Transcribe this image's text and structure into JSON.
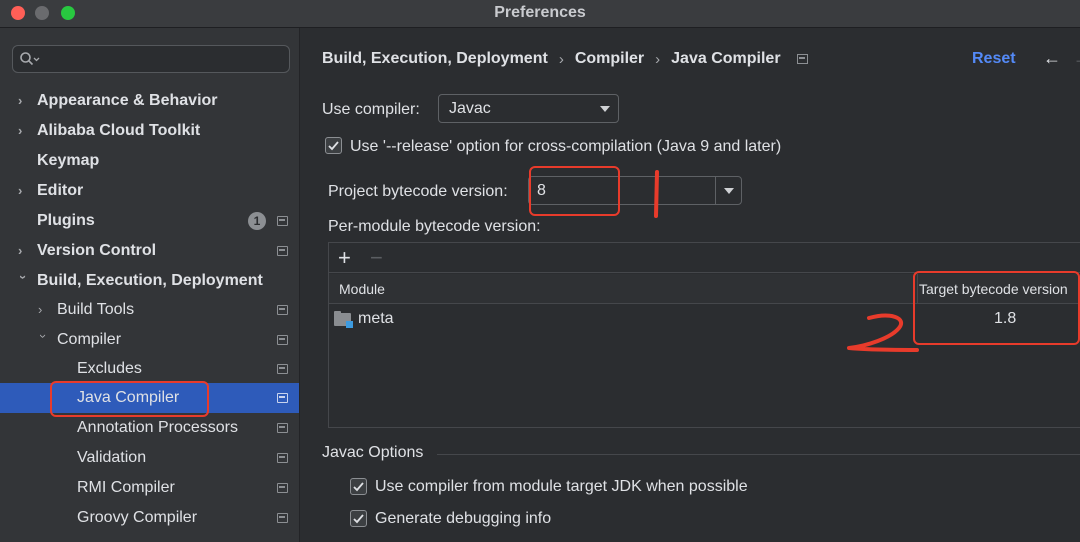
{
  "window": {
    "title": "Preferences"
  },
  "search": {
    "placeholder": ""
  },
  "sidebar": {
    "items": [
      {
        "label": "Appearance & Behavior",
        "bold": true
      },
      {
        "label": "Alibaba Cloud Toolkit",
        "bold": true
      },
      {
        "label": "Keymap",
        "bold": true
      },
      {
        "label": "Editor",
        "bold": true
      },
      {
        "label": "Plugins",
        "bold": true,
        "badge": "1"
      },
      {
        "label": "Version Control",
        "bold": true
      },
      {
        "label": "Build, Execution, Deployment",
        "bold": true,
        "expanded": true
      },
      {
        "label": "Build Tools"
      },
      {
        "label": "Compiler",
        "expanded": true
      },
      {
        "label": "Excludes"
      },
      {
        "label": "Java Compiler",
        "selected": true
      },
      {
        "label": "Annotation Processors"
      },
      {
        "label": "Validation"
      },
      {
        "label": "RMI Compiler"
      },
      {
        "label": "Groovy Compiler"
      }
    ]
  },
  "breadcrumb": {
    "parts": [
      "Build, Execution, Deployment",
      "Compiler",
      "Java Compiler"
    ],
    "separator": "›"
  },
  "header": {
    "reset_label": "Reset",
    "back_icon": "←",
    "forward_icon": "→"
  },
  "compiler": {
    "use_compiler_label": "Use compiler:",
    "use_compiler_value": "Javac",
    "release_option_label": "Use '--release' option for cross-compilation (Java 9 and later)",
    "release_option_checked": true,
    "project_bytecode_label": "Project bytecode version:",
    "project_bytecode_value": "8",
    "per_module_label": "Per-module bytecode version:"
  },
  "module_table": {
    "add_icon": "+",
    "remove_icon": "−",
    "columns": [
      "Module",
      "Target bytecode version"
    ],
    "rows": [
      {
        "module": "meta",
        "target": "1.8"
      }
    ]
  },
  "javac_options": {
    "title": "Javac Options",
    "use_module_jdk_label": "Use compiler from module target JDK when possible",
    "use_module_jdk_checked": true,
    "debug_info_label": "Generate debugging info",
    "debug_info_checked": true
  },
  "annotations": {
    "mark_1": "1",
    "mark_2": "2",
    "color": "#e83b2b"
  },
  "colors": {
    "accent": "#548af7",
    "selection": "#2e5bba",
    "background": "#2b2d30",
    "sidebar": "#333538"
  }
}
